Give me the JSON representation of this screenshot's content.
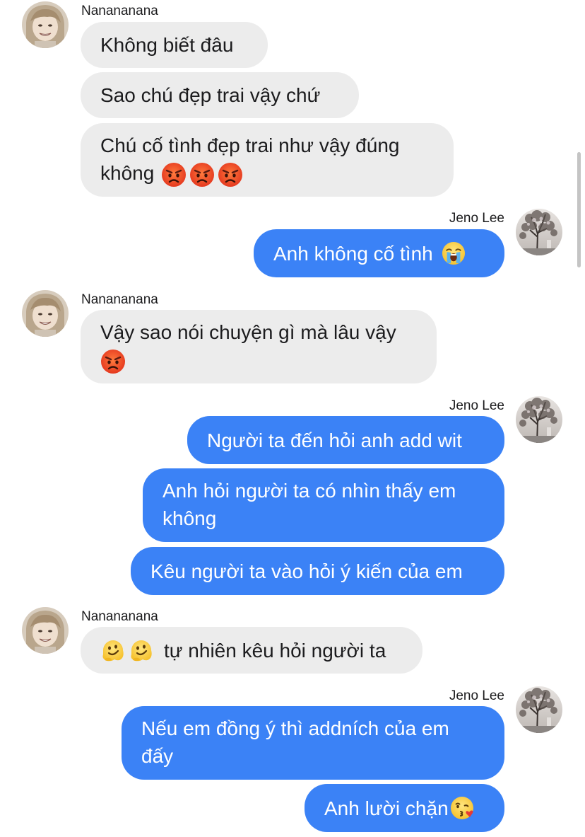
{
  "contacts": {
    "other": {
      "name": "Nanananana"
    },
    "me": {
      "name": "Jeno Lee"
    }
  },
  "messages": {
    "m1": "Không biết đâu",
    "m2": "Sao chú đẹp trai vậy chứ",
    "m3_line1": "Chú cố tình đẹp trai như vậy đúng",
    "m3_line2": "không",
    "m4": "Anh không cố tình",
    "m5_line1": "Vậy sao nói chuyện gì mà lâu vậy",
    "m6": "Người ta đến hỏi anh add wit",
    "m7_line1": "Anh hỏi người ta có nhìn thấy em",
    "m7_line2": "không",
    "m8": "Kêu người ta vào hỏi ý kiến của em",
    "m9": "tự nhiên kêu hỏi người ta",
    "m10_line1": "Nếu em đồng ý thì addních của em",
    "m10_line2": "đấy",
    "m11": "Anh lười chặn"
  },
  "emoji": {
    "m3": [
      "pouting-face",
      "pouting-face",
      "pouting-face"
    ],
    "m4": [
      "loudly-crying-face"
    ],
    "m5": [
      "pouting-face"
    ],
    "m9": [
      "melting-face",
      "melting-face"
    ],
    "m11": [
      "face-blowing-a-kiss"
    ]
  },
  "colors": {
    "incoming_bubble": "#ececec",
    "outgoing_bubble": "#3b82f6",
    "text_dark": "#1c1c1e",
    "text_light": "#ffffff"
  }
}
